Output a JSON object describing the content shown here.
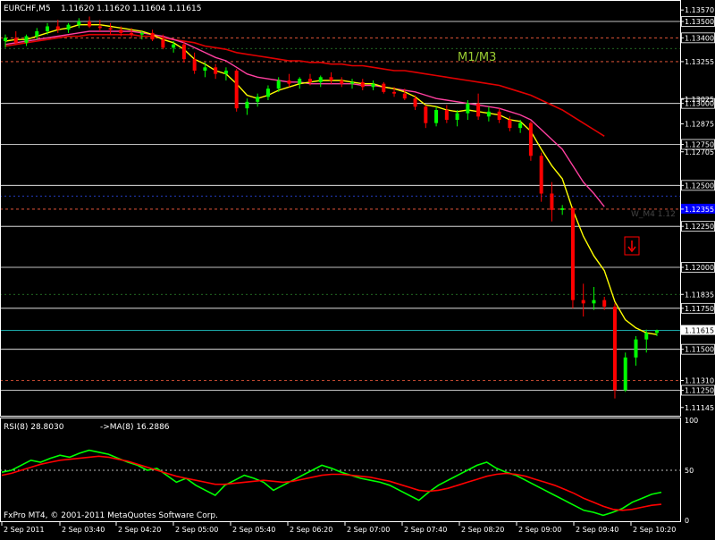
{
  "header": {
    "symbol": "EURCHF,M5",
    "ohlc": "1.11620 1.11620 1.11604 1.11615"
  },
  "annotations": {
    "zone_label": "M1/M3",
    "line_label": "W_M4 1.12",
    "copyright": "FxPro MT4, © 2001-2011 MetaQuotes Software Corp."
  },
  "indicator": {
    "rsi_label": "RSI(8) 28.8030",
    "ma_label": "->MA(8) 16.2886"
  },
  "colors": {
    "background": "#000000",
    "axis": "#ffffff",
    "bull": "#00ff00",
    "bear": "#ff0000",
    "ma_fast": "#ffff00",
    "ma_mid": "#ff40a0",
    "ma_slow": "#e00000",
    "rsi_line": "#00ff00",
    "rsi_ma": "#ff0000",
    "current_price_bg": "#ffffff",
    "highlight_label_bg": "#0000ff"
  },
  "chart_data": [
    {
      "type": "candlestick",
      "title": "EURCHF,M5",
      "y_ticks": [
        "1.13570",
        "1.13500",
        "1.13400",
        "1.13255",
        "1.13025",
        "1.13000",
        "1.12875",
        "1.12750",
        "1.12705",
        "1.12500",
        "1.12355",
        "1.12250",
        "1.12000",
        "1.11835",
        "1.11750",
        "1.11615",
        "1.11500",
        "1.11310",
        "1.11250",
        "1.11145"
      ],
      "y_tick_values": [
        1.1357,
        1.135,
        1.134,
        1.13255,
        1.13025,
        1.13,
        1.12875,
        1.1275,
        1.12705,
        1.125,
        1.12355,
        1.1225,
        1.12,
        1.11835,
        1.1175,
        1.11615,
        1.115,
        1.1131,
        1.1125,
        1.11145
      ],
      "boxed_ticks": [
        "1.13500",
        "1.13400",
        "1.13000",
        "1.12750",
        "1.12500",
        "1.12250",
        "1.12000",
        "1.11750",
        "1.11615",
        "1.11500",
        "1.11250"
      ],
      "highlighted_tick": "1.12355",
      "current_price": "1.11615",
      "ylim": [
        1.111,
        1.1362
      ],
      "x_labels": [
        "2 Sep 2011",
        "2 Sep 03:40",
        "2 Sep 04:20",
        "2 Sep 05:00",
        "2 Sep 05:40",
        "2 Sep 06:20",
        "2 Sep 07:00",
        "2 Sep 07:40",
        "2 Sep 08:20",
        "2 Sep 09:00",
        "2 Sep 09:40",
        "2 Sep 10:20"
      ],
      "horizontal_levels": {
        "white": [
          1.135,
          1.13,
          1.1275,
          1.125,
          1.1225,
          1.12,
          1.1175,
          1.115,
          1.1125
        ],
        "red_dashed": [
          1.134,
          1.13255,
          1.12355,
          1.1131
        ],
        "green_dashed": [
          1.13335,
          1.11835
        ],
        "blue_dashed": [
          1.12435
        ],
        "cyan": [
          1.11615
        ]
      },
      "candles": [
        {
          "o": 1.1338,
          "h": 1.1342,
          "l": 1.1334,
          "c": 1.134
        },
        {
          "o": 1.134,
          "h": 1.1344,
          "l": 1.1336,
          "c": 1.1337
        },
        {
          "o": 1.1337,
          "h": 1.1342,
          "l": 1.1335,
          "c": 1.1341
        },
        {
          "o": 1.1341,
          "h": 1.1346,
          "l": 1.1339,
          "c": 1.1344
        },
        {
          "o": 1.1344,
          "h": 1.1349,
          "l": 1.1342,
          "c": 1.1347
        },
        {
          "o": 1.1347,
          "h": 1.1351,
          "l": 1.1343,
          "c": 1.1345
        },
        {
          "o": 1.1345,
          "h": 1.1349,
          "l": 1.1343,
          "c": 1.1348
        },
        {
          "o": 1.1348,
          "h": 1.1352,
          "l": 1.1346,
          "c": 1.135
        },
        {
          "o": 1.135,
          "h": 1.1353,
          "l": 1.1346,
          "c": 1.1347
        },
        {
          "o": 1.1347,
          "h": 1.1351,
          "l": 1.1344,
          "c": 1.1346
        },
        {
          "o": 1.1346,
          "h": 1.1349,
          "l": 1.1342,
          "c": 1.1345
        },
        {
          "o": 1.1345,
          "h": 1.1347,
          "l": 1.1341,
          "c": 1.1343
        },
        {
          "o": 1.1343,
          "h": 1.1346,
          "l": 1.134,
          "c": 1.1342
        },
        {
          "o": 1.1342,
          "h": 1.1344,
          "l": 1.1339,
          "c": 1.1343
        },
        {
          "o": 1.1343,
          "h": 1.1345,
          "l": 1.1338,
          "c": 1.1339
        },
        {
          "o": 1.1339,
          "h": 1.1342,
          "l": 1.1333,
          "c": 1.1334
        },
        {
          "o": 1.1334,
          "h": 1.1338,
          "l": 1.1331,
          "c": 1.1336
        },
        {
          "o": 1.1336,
          "h": 1.1338,
          "l": 1.1325,
          "c": 1.1327
        },
        {
          "o": 1.1327,
          "h": 1.1331,
          "l": 1.1318,
          "c": 1.132
        },
        {
          "o": 1.132,
          "h": 1.1325,
          "l": 1.1316,
          "c": 1.1322
        },
        {
          "o": 1.1322,
          "h": 1.1324,
          "l": 1.1315,
          "c": 1.1318
        },
        {
          "o": 1.1318,
          "h": 1.1322,
          "l": 1.1314,
          "c": 1.132
        },
        {
          "o": 1.132,
          "h": 1.1321,
          "l": 1.1295,
          "c": 1.1297
        },
        {
          "o": 1.1297,
          "h": 1.1303,
          "l": 1.1293,
          "c": 1.1301
        },
        {
          "o": 1.1301,
          "h": 1.1306,
          "l": 1.1298,
          "c": 1.1304
        },
        {
          "o": 1.1304,
          "h": 1.1311,
          "l": 1.1302,
          "c": 1.1309
        },
        {
          "o": 1.1309,
          "h": 1.1316,
          "l": 1.1307,
          "c": 1.1314
        },
        {
          "o": 1.1314,
          "h": 1.1318,
          "l": 1.131,
          "c": 1.1312
        },
        {
          "o": 1.1312,
          "h": 1.1316,
          "l": 1.1309,
          "c": 1.1315
        },
        {
          "o": 1.1315,
          "h": 1.1318,
          "l": 1.1311,
          "c": 1.1313
        },
        {
          "o": 1.1313,
          "h": 1.1317,
          "l": 1.131,
          "c": 1.1316
        },
        {
          "o": 1.1316,
          "h": 1.1319,
          "l": 1.1312,
          "c": 1.1314
        },
        {
          "o": 1.1314,
          "h": 1.1316,
          "l": 1.131,
          "c": 1.1312
        },
        {
          "o": 1.1312,
          "h": 1.1315,
          "l": 1.1309,
          "c": 1.1313
        },
        {
          "o": 1.1313,
          "h": 1.1315,
          "l": 1.1308,
          "c": 1.131
        },
        {
          "o": 1.131,
          "h": 1.1314,
          "l": 1.1308,
          "c": 1.1312
        },
        {
          "o": 1.1312,
          "h": 1.1313,
          "l": 1.1306,
          "c": 1.1307
        },
        {
          "o": 1.1307,
          "h": 1.131,
          "l": 1.1304,
          "c": 1.1306
        },
        {
          "o": 1.1306,
          "h": 1.1309,
          "l": 1.1302,
          "c": 1.1303
        },
        {
          "o": 1.1303,
          "h": 1.1305,
          "l": 1.1296,
          "c": 1.1298
        },
        {
          "o": 1.1298,
          "h": 1.1299,
          "l": 1.1285,
          "c": 1.1288
        },
        {
          "o": 1.1288,
          "h": 1.1298,
          "l": 1.1286,
          "c": 1.1296
        },
        {
          "o": 1.1296,
          "h": 1.1299,
          "l": 1.1288,
          "c": 1.129
        },
        {
          "o": 1.129,
          "h": 1.1296,
          "l": 1.1286,
          "c": 1.1294
        },
        {
          "o": 1.1294,
          "h": 1.1302,
          "l": 1.129,
          "c": 1.13
        },
        {
          "o": 1.13,
          "h": 1.1306,
          "l": 1.129,
          "c": 1.1292
        },
        {
          "o": 1.1292,
          "h": 1.1298,
          "l": 1.1289,
          "c": 1.1295
        },
        {
          "o": 1.1295,
          "h": 1.1297,
          "l": 1.1288,
          "c": 1.129
        },
        {
          "o": 1.129,
          "h": 1.1292,
          "l": 1.1283,
          "c": 1.1285
        },
        {
          "o": 1.1285,
          "h": 1.129,
          "l": 1.1282,
          "c": 1.1288
        },
        {
          "o": 1.1288,
          "h": 1.1289,
          "l": 1.1265,
          "c": 1.1268
        },
        {
          "o": 1.1268,
          "h": 1.127,
          "l": 1.124,
          "c": 1.1245
        },
        {
          "o": 1.1245,
          "h": 1.1252,
          "l": 1.1228,
          "c": 1.1235
        },
        {
          "o": 1.1235,
          "h": 1.1238,
          "l": 1.1232,
          "c": 1.1236
        },
        {
          "o": 1.1236,
          "h": 1.1237,
          "l": 1.1175,
          "c": 1.118
        },
        {
          "o": 1.118,
          "h": 1.119,
          "l": 1.117,
          "c": 1.1178
        },
        {
          "o": 1.1178,
          "h": 1.1188,
          "l": 1.1174,
          "c": 1.118
        },
        {
          "o": 1.118,
          "h": 1.1182,
          "l": 1.1174,
          "c": 1.1176
        },
        {
          "o": 1.1176,
          "h": 1.1178,
          "l": 1.112,
          "c": 1.1125
        },
        {
          "o": 1.1125,
          "h": 1.1148,
          "l": 1.1124,
          "c": 1.1145
        },
        {
          "o": 1.1145,
          "h": 1.1158,
          "l": 1.114,
          "c": 1.1156
        },
        {
          "o": 1.1156,
          "h": 1.1162,
          "l": 1.1148,
          "c": 1.116
        },
        {
          "o": 1.116,
          "h": 1.1162,
          "l": 1.1158,
          "c": 1.11615
        }
      ],
      "ma_fast": [
        1.1338,
        1.1339,
        1.1339,
        1.1341,
        1.1343,
        1.1345,
        1.1346,
        1.1348,
        1.1348,
        1.1348,
        1.1347,
        1.1346,
        1.1345,
        1.1344,
        1.1342,
        1.1339,
        1.1337,
        1.1333,
        1.1327,
        1.1324,
        1.132,
        1.1318,
        1.1312,
        1.1305,
        1.1303,
        1.1305,
        1.1308,
        1.131,
        1.1312,
        1.1313,
        1.1314,
        1.1314,
        1.1314,
        1.1313,
        1.1312,
        1.1312,
        1.131,
        1.1309,
        1.1307,
        1.1304,
        1.1299,
        1.1298,
        1.1296,
        1.1295,
        1.1296,
        1.1295,
        1.1294,
        1.1293,
        1.129,
        1.1289,
        1.1283,
        1.1272,
        1.1262,
        1.1254,
        1.1235,
        1.1219,
        1.1207,
        1.1198,
        1.1179,
        1.1168,
        1.1163,
        1.116,
        1.1159
      ],
      "ma_mid": [
        1.1336,
        1.1337,
        1.1338,
        1.1339,
        1.134,
        1.1341,
        1.1342,
        1.1343,
        1.1344,
        1.1344,
        1.1344,
        1.1344,
        1.1344,
        1.1343,
        1.1342,
        1.1341,
        1.1339,
        1.1337,
        1.1334,
        1.1331,
        1.1328,
        1.1326,
        1.1322,
        1.1318,
        1.1316,
        1.1315,
        1.1314,
        1.1313,
        1.1313,
        1.1312,
        1.1312,
        1.1312,
        1.1312,
        1.1312,
        1.1311,
        1.1311,
        1.131,
        1.1309,
        1.1308,
        1.1307,
        1.1305,
        1.1303,
        1.1302,
        1.1301,
        1.13,
        1.1299,
        1.1298,
        1.1297,
        1.1295,
        1.1293,
        1.129,
        1.1284,
        1.1278,
        1.1272,
        1.1262,
        1.1252,
        1.1245,
        1.1237
      ],
      "ma_slow": [
        1.1335,
        1.1336,
        1.1337,
        1.1338,
        1.1339,
        1.134,
        1.1341,
        1.1341,
        1.1342,
        1.1342,
        1.1342,
        1.1342,
        1.1342,
        1.1341,
        1.1341,
        1.134,
        1.1339,
        1.1338,
        1.1337,
        1.1335,
        1.1334,
        1.1333,
        1.1331,
        1.133,
        1.1329,
        1.1328,
        1.1327,
        1.1326,
        1.1326,
        1.1325,
        1.1325,
        1.1324,
        1.1324,
        1.1323,
        1.1323,
        1.1322,
        1.1321,
        1.132,
        1.132,
        1.1319,
        1.1318,
        1.1317,
        1.1316,
        1.1315,
        1.1314,
        1.1313,
        1.1312,
        1.1311,
        1.1309,
        1.1307,
        1.1305,
        1.1302,
        1.1299,
        1.1296,
        1.1292,
        1.1288,
        1.1284,
        1.128
      ]
    },
    {
      "type": "line",
      "title": "RSI(8) 28.8030 ->MA(8) 16.2886",
      "y_ticks": [
        "100",
        "50",
        "0"
      ],
      "ylim": [
        0,
        100
      ],
      "levels": [
        50
      ],
      "series": [
        {
          "name": "RSI(8)",
          "values": [
            48,
            50,
            55,
            60,
            58,
            62,
            65,
            63,
            67,
            70,
            68,
            66,
            62,
            58,
            55,
            50,
            52,
            45,
            38,
            42,
            35,
            30,
            25,
            35,
            40,
            45,
            42,
            38,
            30,
            35,
            40,
            45,
            50,
            55,
            52,
            48,
            45,
            42,
            40,
            38,
            35,
            30,
            25,
            20,
            28,
            35,
            40,
            45,
            50,
            55,
            58,
            52,
            48,
            45,
            40,
            35,
            30,
            25,
            20,
            15,
            10,
            8,
            5,
            8,
            12,
            18,
            22,
            26,
            28
          ]
        },
        {
          "name": "->MA(8)",
          "values": [
            45,
            47,
            50,
            53,
            56,
            58,
            60,
            61,
            62,
            63,
            64,
            63,
            61,
            59,
            56,
            53,
            50,
            47,
            44,
            42,
            40,
            38,
            36,
            36,
            37,
            38,
            39,
            40,
            39,
            38,
            39,
            41,
            43,
            45,
            46,
            46,
            45,
            44,
            43,
            41,
            39,
            36,
            33,
            30,
            29,
            30,
            32,
            35,
            38,
            41,
            44,
            46,
            47,
            46,
            44,
            41,
            38,
            35,
            31,
            27,
            22,
            18,
            14,
            11,
            10,
            11,
            13,
            15,
            16
          ]
        }
      ]
    }
  ]
}
